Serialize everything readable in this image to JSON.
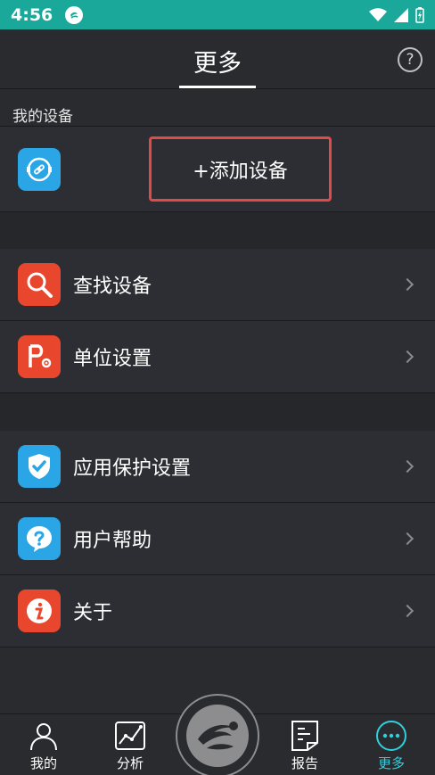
{
  "status_bar": {
    "time": "4:56"
  },
  "header": {
    "title": "更多",
    "help_glyph": "?"
  },
  "my_devices": {
    "section_label": "我的设备",
    "add_device_label": "+添加设备"
  },
  "menu_group_1": [
    {
      "label": "查找设备",
      "icon": "search-icon",
      "color": "#e8472d"
    },
    {
      "label": "单位设置",
      "icon": "unit-settings-icon",
      "color": "#e8472d"
    }
  ],
  "menu_group_2": [
    {
      "label": "应用保护设置",
      "icon": "shield-check-icon",
      "color": "#2aa6e6"
    },
    {
      "label": "用户帮助",
      "icon": "help-bubble-icon",
      "color": "#2aa6e6"
    },
    {
      "label": "关于",
      "icon": "info-icon",
      "color": "#e8472d"
    }
  ],
  "bottom_nav": {
    "items": [
      {
        "label": "我的",
        "icon": "person-icon"
      },
      {
        "label": "分析",
        "icon": "chart-icon"
      },
      {
        "label": "报告",
        "icon": "report-icon"
      },
      {
        "label": "更多",
        "icon": "more-icon"
      }
    ],
    "active_index": 3,
    "active_color": "#2fd0dc"
  },
  "colors": {
    "status_bar": "#1aa89a",
    "background": "#2a2b2f",
    "row": "#2d2e33",
    "accent_red": "#e34a47"
  }
}
